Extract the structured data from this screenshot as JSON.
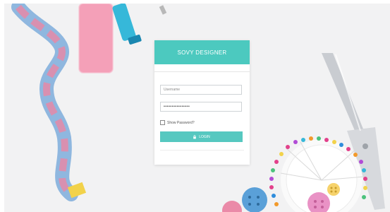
{
  "login": {
    "brand_title": "SOVY DESIGNER",
    "username_placeholder": "Username",
    "password_value": "••••••••••••••••",
    "show_password_label": "Show Password?",
    "login_button_label": "LOGIN"
  },
  "theme": {
    "accent": "#4cc9bf",
    "button_bg": "#56c8c0"
  },
  "icons": {
    "login_button_icon": "lock-icon"
  }
}
